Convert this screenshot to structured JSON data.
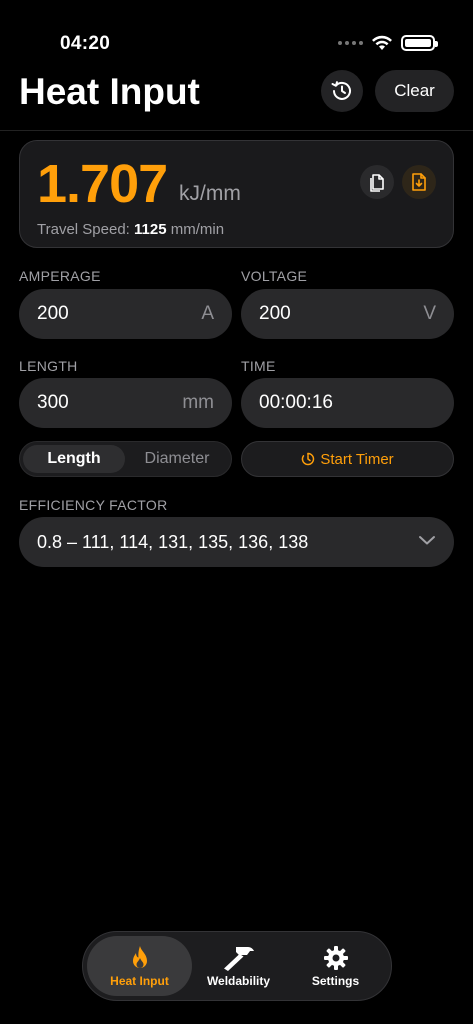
{
  "status_bar": {
    "time": "04:20"
  },
  "header": {
    "title": "Heat Input",
    "clear_label": "Clear"
  },
  "result": {
    "value": "1.707",
    "unit": "kJ/mm",
    "travel_speed_label": "Travel Speed:",
    "travel_speed_value": "1125",
    "travel_speed_unit": "mm/min"
  },
  "inputs": {
    "amperage": {
      "label": "AMPERAGE",
      "value": "200",
      "unit": "A"
    },
    "voltage": {
      "label": "VOLTAGE",
      "value": "200",
      "unit": "V"
    },
    "length": {
      "label": "LENGTH",
      "value": "300",
      "unit": "mm"
    },
    "time": {
      "label": "TIME",
      "value": "00:00:16"
    }
  },
  "segment": {
    "options": [
      "Length",
      "Diameter"
    ],
    "selected": "Length"
  },
  "timer": {
    "label": "Start Timer"
  },
  "efficiency": {
    "label": "EFFICIENCY FACTOR",
    "value": "0.8 – 111, 114, 131, 135, 136, 138"
  },
  "tabs": [
    {
      "label": "Heat Input",
      "icon": "flame-icon",
      "active": true
    },
    {
      "label": "Weldability",
      "icon": "hammer-icon",
      "active": false
    },
    {
      "label": "Settings",
      "icon": "gear-icon",
      "active": false
    }
  ],
  "colors": {
    "accent": "#ff9f0a",
    "background": "#000000",
    "field": "#29292b",
    "card": "#1a1a1c"
  }
}
